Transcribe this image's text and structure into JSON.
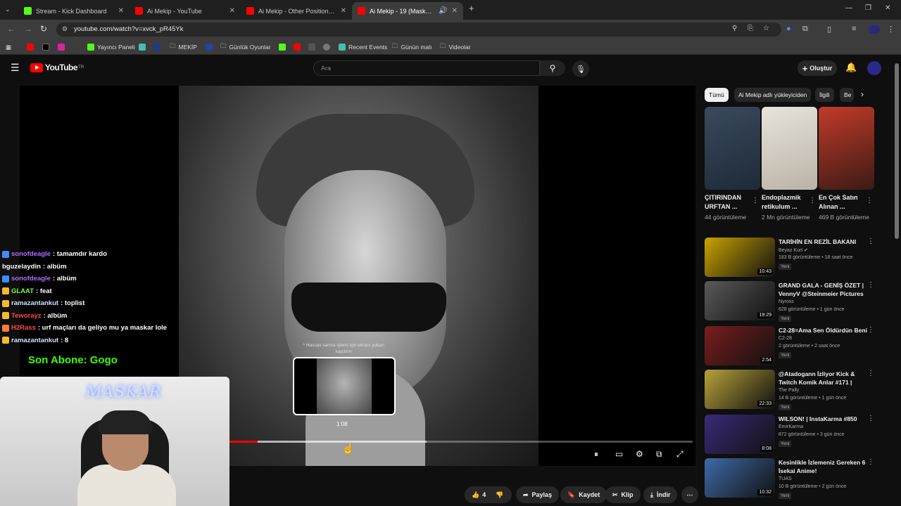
{
  "browser": {
    "tabs": [
      {
        "title": "Stream - Kick Dashboard",
        "color": "#53fc18"
      },
      {
        "title": "Ai Mekip - YouTube",
        "color": "#ff0000"
      },
      {
        "title": "Ai Mekip - Other Position (Cyb",
        "color": "#ff0000"
      },
      {
        "title": "Ai Mekip - 19 (Maskar) - Yo",
        "color": "#ff0000"
      }
    ],
    "url": "youtube.com/watch?v=xvck_pR45Yk",
    "bookmarks": {
      "yayinci_paneli": "Yayıncı Paneli",
      "mekip": "MEKİP",
      "gunluk_oyunlar": "Günlük Oyunlar",
      "recent_events": "Recent Events",
      "gunun_mali": "Günün malı",
      "videolar": "Videolar"
    }
  },
  "youtube": {
    "logo": "YouTube",
    "region": "TR",
    "search_placeholder": "Ara",
    "create_label": "Oluştur"
  },
  "player": {
    "scrub_tip": "^ Hassas sarma işlemi için ekranı yukarı kaydırın",
    "preview_time": "1:08"
  },
  "stream_overlay": {
    "chat": [
      {
        "user": "sonofdeagle",
        "text": ": tamamdır kardo",
        "color": "#b06cff",
        "badge": "#3b8cff"
      },
      {
        "user": "bguzelaydin",
        "text": ": albüm",
        "color": "#ffffff",
        "badge": ""
      },
      {
        "user": "sonofdeagle",
        "text": ": albüm",
        "color": "#b06cff",
        "badge": "#3b8cff"
      },
      {
        "user": "GLAAT",
        "text": ": feat",
        "color": "#7cff3c",
        "badge": "#f5b82e"
      },
      {
        "user": "ramazantankut",
        "text": ": toplist",
        "color": "#cfe6ff",
        "badge": "#f5b82e"
      },
      {
        "user": "Teworayz",
        "text": ": albüm",
        "color": "#ff4a4a",
        "badge": "#f5b82e"
      },
      {
        "user": "H2Rass",
        "text": ": urf maçları da geliyo mu ya maskar lole",
        "color": "#ff4a4a",
        "badge": "#ff7a3c"
      },
      {
        "user": "ramazantankut",
        "text": ": 8",
        "color": "#cfe6ff",
        "badge": "#f5b82e"
      }
    ],
    "last_sub": "Son Abone: Gogo",
    "cam_label": "MASKAR"
  },
  "sidebar": {
    "chips": [
      "Tümü",
      "Ai Mekip adlı yükleyiciden",
      "İlgili",
      "Be"
    ],
    "shorts": [
      {
        "title": "ÇITIRINDAN URFTAN ...",
        "views": "44 görüntüleme",
        "colors": [
          "#3a4a5c",
          "#1d2a38"
        ]
      },
      {
        "title": "Endoplazmik retikulum ...",
        "views": "2 Mn görüntüleme",
        "colors": [
          "#e8e4dc",
          "#b9b2a6"
        ]
      },
      {
        "title": "En Çok Satın Alınan ...",
        "views": "469 B görüntüleme",
        "colors": [
          "#c23b2a",
          "#3b1a14"
        ]
      }
    ],
    "recommendations": [
      {
        "title": "TARİHİN EN REZİL BAKANI",
        "channel": "Beyaz Kurt ✔",
        "views": "183 B görüntüleme • 18 saat önce",
        "badge": "Yeni",
        "duration": "10:43",
        "color": "#c9a300"
      },
      {
        "title": "GRAND GALA - GENİŞ ÖZET | VennyV @Steinmeier Pictures",
        "channel": "Nyross",
        "views": "628 görüntüleme • 1 gün önce",
        "badge": "Yeni",
        "duration": "19:29",
        "color": "#5a5a5a"
      },
      {
        "title": "C2-28=Ama Sen Öldürdün Beni",
        "channel": "C2-28",
        "views": "2 görüntüleme • 2 saat önce",
        "badge": "Yeni",
        "duration": "2:54",
        "color": "#7a1d1d"
      },
      {
        "title": "@Atadogann İzliyor Kick & Twitch Komik Anlar #171 | The...",
        "channel": "The Pally",
        "views": "14 B görüntüleme • 1 gün önce",
        "badge": "Yeni",
        "duration": "22:33",
        "color": "#b8a23a"
      },
      {
        "title": "WILSON! | InstaKarma #850",
        "channel": "EmirKarma",
        "views": "872 görüntüleme • 3 gün önce",
        "badge": "Yeni",
        "duration": "8:08",
        "color": "#3b2a7a"
      },
      {
        "title": "Kesinlikle İzlemeniz Gereken 6 İsekai Anime!",
        "channel": "TUAS",
        "views": "10 B görüntüleme • 2 gün önce",
        "badge": "Yeni",
        "duration": "10:32",
        "color": "#3f6aa8"
      }
    ]
  },
  "actions": {
    "likes": "4",
    "share": "Paylaş",
    "save": "Kaydet",
    "clip": "Klip",
    "download": "İndir"
  }
}
